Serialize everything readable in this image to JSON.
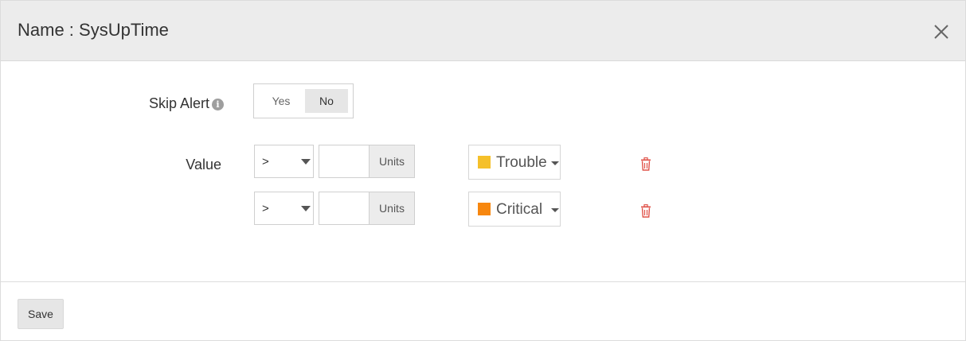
{
  "dialog": {
    "title": "Name : SysUpTime",
    "close_icon": "close-icon"
  },
  "skip_alert": {
    "label": "Skip Alert",
    "info_icon": "info-icon",
    "info_glyph": "i",
    "options": [
      "Yes",
      "No"
    ],
    "selected": "No"
  },
  "value": {
    "label": "Value",
    "rows": [
      {
        "operator": ">",
        "amount": "",
        "units": "Units",
        "severity": "Trouble",
        "severity_color": "#f5c02a"
      },
      {
        "operator": ">",
        "amount": "",
        "units": "Units",
        "severity": "Critical",
        "severity_color": "#f7870f"
      }
    ],
    "delete_icon": "trash-icon",
    "delete_color": "#e0534a"
  },
  "footer": {
    "save_label": "Save"
  },
  "colors": {
    "header_bg": "#ececec",
    "toggle_selected_bg": "#e6e6e6"
  }
}
